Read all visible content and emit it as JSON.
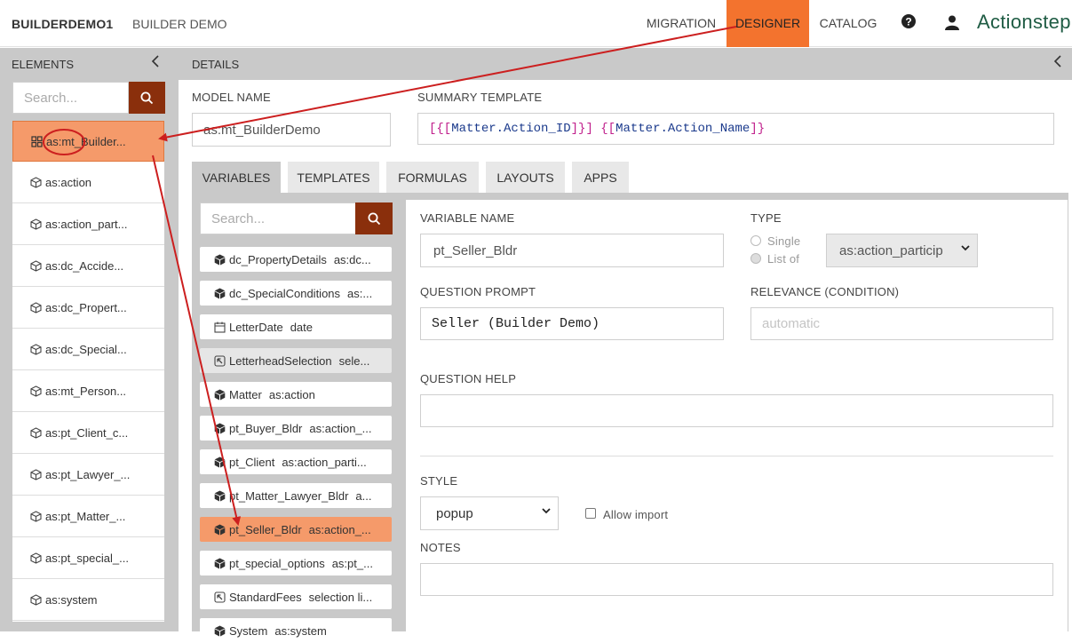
{
  "topbar": {
    "brand": "BUILDERDEMO1",
    "subtitle": "BUILDER DEMO",
    "nav": [
      "MIGRATION",
      "DESIGNER",
      "CATALOG"
    ],
    "active_nav": "DESIGNER",
    "help_icon": "help-circle-icon",
    "user_icon": "user-icon",
    "logo": "Actionstep",
    "accent_color": "#f3732e"
  },
  "elements": {
    "title": "ELEMENTS",
    "search_placeholder": "Search...",
    "items": [
      "as:mt_Builder...",
      "as:action",
      "as:action_part...",
      "as:dc_Accide...",
      "as:dc_Propert...",
      "as:dc_Special...",
      "as:mt_Person...",
      "as:pt_Client_c...",
      "as:pt_Lawyer_...",
      "as:pt_Matter_...",
      "as:pt_special_...",
      "as:system"
    ],
    "selected_index": 0
  },
  "details": {
    "title": "DETAILS",
    "model_name_label": "MODEL NAME",
    "model_name_value": "as:mt_BuilderDemo",
    "summary_label": "SUMMARY TEMPLATE",
    "summary_value": {
      "open1": "[{[",
      "field1": "Matter.Action_ID",
      "close1": "]}]",
      "open2": "{[",
      "field2": "Matter.Action_Name",
      "close2": "]}"
    },
    "tabs": [
      "VARIABLES",
      "TEMPLATES",
      "FORMULAS",
      "LAYOUTS",
      "APPS"
    ],
    "active_tab": "VARIABLES"
  },
  "variables": {
    "search_placeholder": "Search...",
    "items": [
      {
        "name": "dc_PropertyDetails",
        "type": "as:dc...",
        "icon": "cube-icon"
      },
      {
        "name": "dc_SpecialConditions",
        "type": "as:...",
        "icon": "cube-icon"
      },
      {
        "name": "LetterDate",
        "type": "date",
        "icon": "calendar-icon"
      },
      {
        "name": "LetterheadSelection",
        "type": "sele...",
        "icon": "selection-icon"
      },
      {
        "name": "Matter",
        "type": "as:action",
        "icon": "cube-icon"
      },
      {
        "name": "pt_Buyer_Bldr",
        "type": "as:action_...",
        "icon": "cube-icon"
      },
      {
        "name": "pt_Client",
        "type": "as:action_parti...",
        "icon": "cube-icon"
      },
      {
        "name": "pt_Matter_Lawyer_Bldr",
        "type": "a...",
        "icon": "cube-icon"
      },
      {
        "name": "pt_Seller_Bldr",
        "type": "as:action_...",
        "icon": "cube-icon"
      },
      {
        "name": "pt_special_options",
        "type": "as:pt_...",
        "icon": "cube-icon"
      },
      {
        "name": "StandardFees",
        "type": "selection li...",
        "icon": "selection-icon"
      },
      {
        "name": "System",
        "type": "as:system",
        "icon": "cube-icon"
      }
    ],
    "selected_index": 8
  },
  "form": {
    "variable_name_label": "VARIABLE NAME",
    "variable_name_value": "pt_Seller_Bldr",
    "type_label": "TYPE",
    "type_single": "Single",
    "type_list": "List of",
    "type_select_value": "as:action_particip",
    "question_prompt_label": "QUESTION PROMPT",
    "question_prompt_value": "Seller (Builder Demo)",
    "relevance_label": "RELEVANCE (CONDITION)",
    "relevance_placeholder": "automatic",
    "question_help_label": "QUESTION HELP",
    "question_help_value": "",
    "style_label": "STYLE",
    "style_value": "popup",
    "allow_import_label": "Allow import",
    "notes_label": "NOTES",
    "notes_value": ""
  },
  "colors": {
    "selected_bg": "#f59a6a",
    "search_button": "#8a2f0c",
    "annotation": "#cc1f1f",
    "code_bracket": "#c0208c",
    "code_field": "#1b3a8c"
  }
}
